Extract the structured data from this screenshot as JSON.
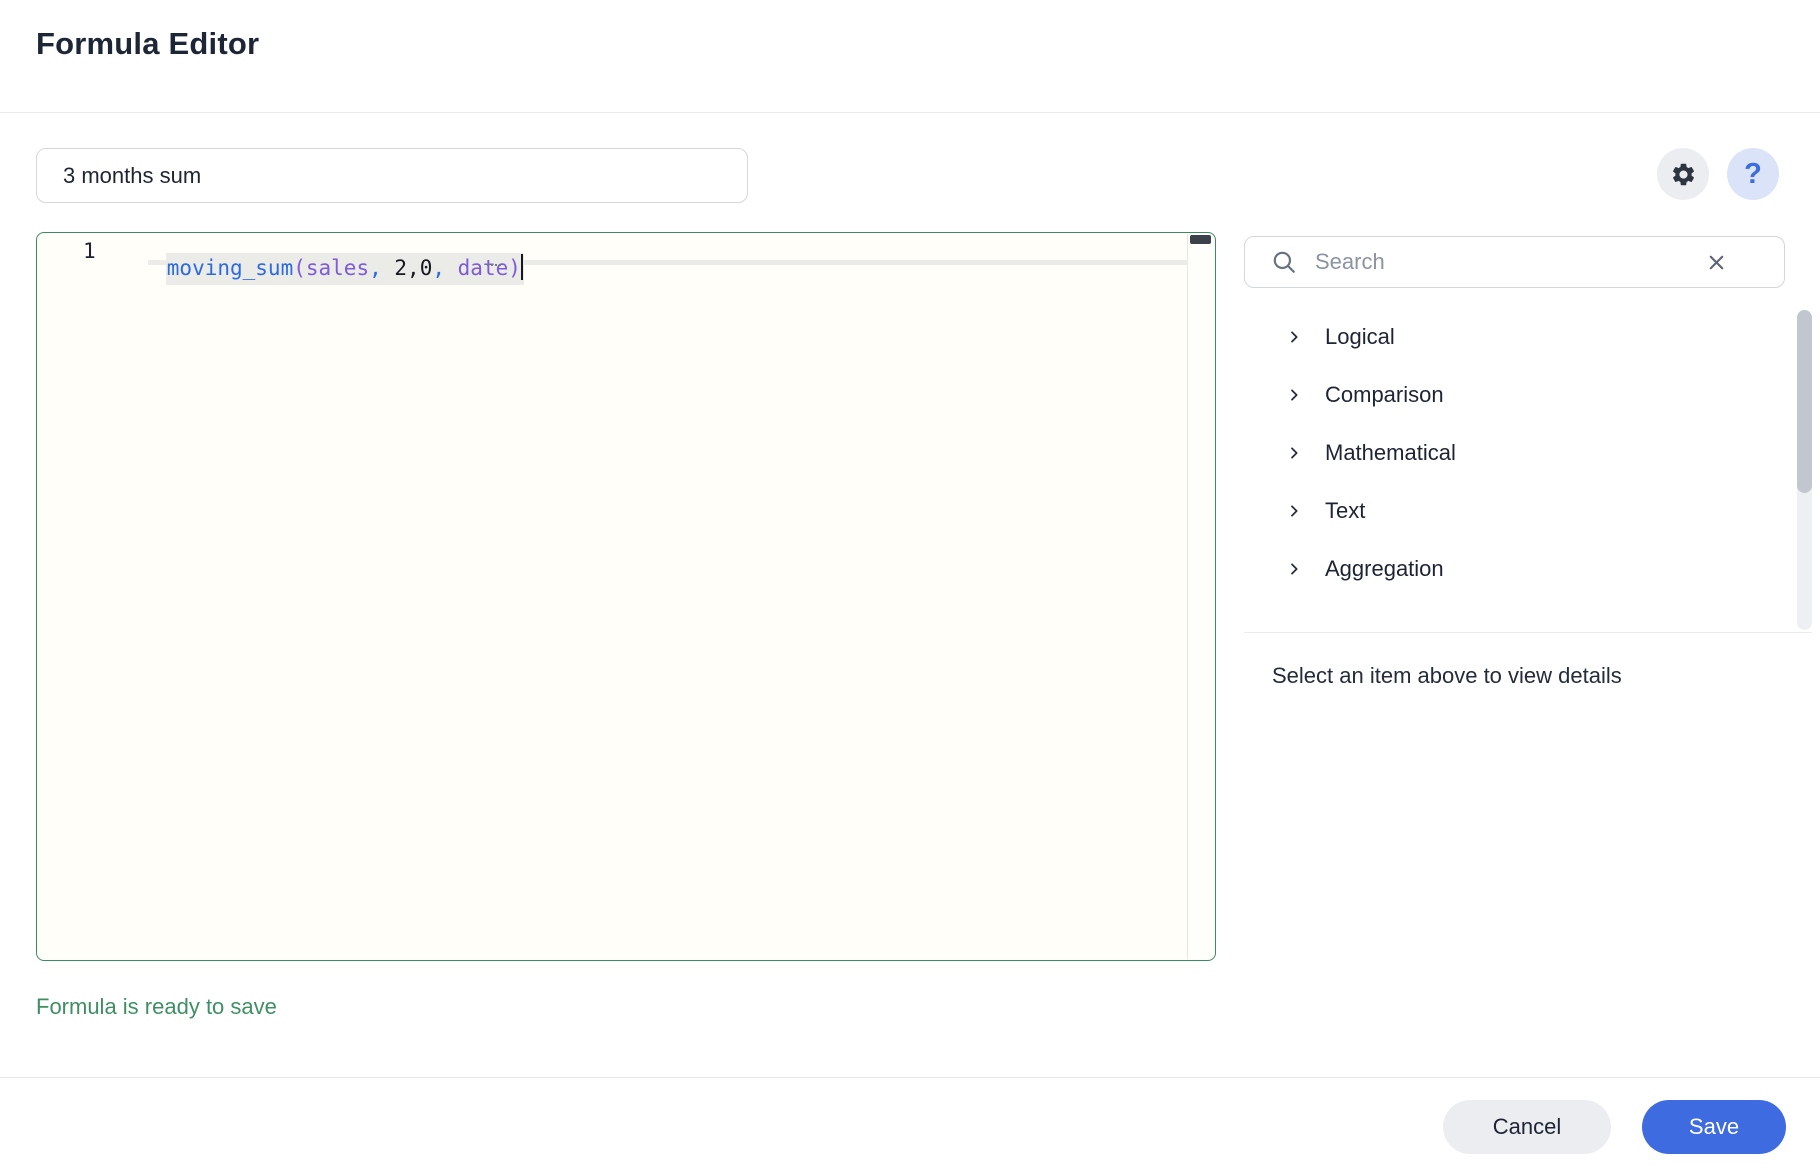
{
  "window": {
    "title": "Formula Editor"
  },
  "formula_name": {
    "value": "3 months sum"
  },
  "actions": {
    "help_label": "?"
  },
  "editor": {
    "line_number": "1",
    "formula_text": "moving_sum(sales, 2,0, date)",
    "tokens": [
      {
        "text": "moving_sum",
        "type": "function"
      },
      {
        "text": "(",
        "type": "bracket"
      },
      {
        "text": "sales",
        "type": "field"
      },
      {
        "text": ",",
        "type": "comma"
      },
      {
        "text": " ",
        "type": "plain"
      },
      {
        "text": "2,0",
        "type": "number"
      },
      {
        "text": ",",
        "type": "comma"
      },
      {
        "text": " ",
        "type": "plain"
      },
      {
        "text": "date",
        "type": "field"
      },
      {
        "text": ")",
        "type": "bracket"
      }
    ],
    "token_colors": {
      "function": "#2d6ae0",
      "bracket": "#7e5bd8",
      "field": "#7e5bd8",
      "comma": "#2d6ae0",
      "number": "#15181e",
      "plain": "#15181e"
    }
  },
  "status": {
    "message": "Formula is ready to save",
    "color": "#3f8f63"
  },
  "function_panel": {
    "search": {
      "placeholder": "Search",
      "value": ""
    },
    "categories": [
      {
        "label": "Logical"
      },
      {
        "label": "Comparison"
      },
      {
        "label": "Mathematical"
      },
      {
        "label": "Text"
      },
      {
        "label": "Aggregation"
      }
    ],
    "details_hint": "Select an item above to view details"
  },
  "footer": {
    "cancel_label": "Cancel",
    "save_label": "Save"
  },
  "colors": {
    "accent_blue": "#3e6be0",
    "success_green": "#3f8f63",
    "editor_border_green": "#3c8a64"
  }
}
